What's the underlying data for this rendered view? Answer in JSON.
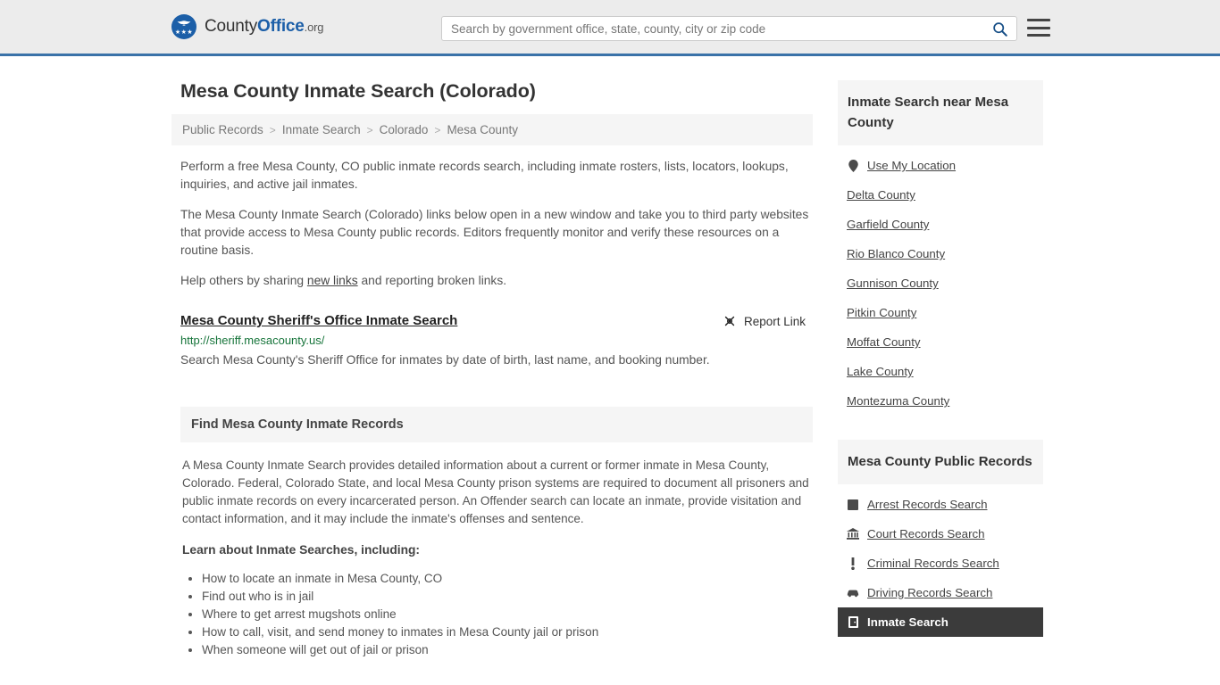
{
  "header": {
    "brand": {
      "part1": "County",
      "part2": "Office",
      "part3": ".org",
      "logo_icon": "eagle-seal-icon",
      "stars": "★★★"
    },
    "search": {
      "placeholder": "Search by government office, state, county, city or zip code",
      "value": "",
      "search_icon": "search-icon"
    },
    "menu_icon": "hamburger-menu-icon",
    "accent_color": "#3a72a8"
  },
  "page": {
    "title": "Mesa County Inmate Search (Colorado)"
  },
  "breadcrumb": {
    "items": [
      "Public Records",
      "Inmate Search",
      "Colorado",
      "Mesa County"
    ],
    "separator": ">"
  },
  "intro": {
    "p1": "Perform a free Mesa County, CO public inmate records search, including inmate rosters, lists, locators, lookups, inquiries, and active jail inmates.",
    "p2": "The Mesa County Inmate Search (Colorado) links below open in a new window and take you to third party websites that provide access to Mesa County public records. Editors frequently monitor and verify these resources on a routine basis.",
    "p3_before": "Help others by sharing ",
    "p3_link": "new links",
    "p3_after": " and reporting broken links."
  },
  "result": {
    "title": "Mesa County Sheriff's Office Inmate Search",
    "url": "http://sheriff.mesacounty.us/",
    "description": "Search Mesa County's Sheriff Office for inmates by date of birth, last name, and booking number.",
    "report_label": "Report Link",
    "report_icon": "broken-link-icon"
  },
  "records_section": {
    "heading": "Find Mesa County Inmate Records",
    "paragraph": "A Mesa County Inmate Search provides detailed information about a current or former inmate in Mesa County, Colorado. Federal, Colorado State, and local Mesa County prison systems are required to document all prisoners and public inmate records on every incarcerated person. An Offender search can locate an inmate, provide visitation and contact information, and it may include the inmate's offenses and sentence.",
    "subheading": "Learn about Inmate Searches, including:",
    "bullets": [
      "How to locate an inmate in Mesa County, CO",
      "Find out who is in jail",
      "Where to get arrest mugshots online",
      "How to call, visit, and send money to inmates in Mesa County jail or prison",
      "When someone will get out of jail or prison"
    ]
  },
  "sidebar": {
    "nearby": {
      "heading": "Inmate Search near Mesa County",
      "items": [
        {
          "label": "Use My Location",
          "icon": "map-pin-icon"
        },
        {
          "label": "Delta County",
          "icon": ""
        },
        {
          "label": "Garfield County",
          "icon": ""
        },
        {
          "label": "Rio Blanco County",
          "icon": ""
        },
        {
          "label": "Gunnison County",
          "icon": ""
        },
        {
          "label": "Pitkin County",
          "icon": ""
        },
        {
          "label": "Moffat County",
          "icon": ""
        },
        {
          "label": "Lake County",
          "icon": ""
        },
        {
          "label": "Montezuma County",
          "icon": ""
        }
      ]
    },
    "public_records": {
      "heading": "Mesa County Public Records",
      "items": [
        {
          "label": "Arrest Records Search",
          "icon": "filled-square-icon",
          "active": false
        },
        {
          "label": "Court Records Search",
          "icon": "courthouse-icon",
          "active": false
        },
        {
          "label": "Criminal Records Search",
          "icon": "exclamation-icon",
          "active": false
        },
        {
          "label": "Driving Records Search",
          "icon": "car-icon",
          "active": false
        },
        {
          "label": "Inmate Search",
          "icon": "door-icon",
          "active": true
        }
      ]
    }
  }
}
